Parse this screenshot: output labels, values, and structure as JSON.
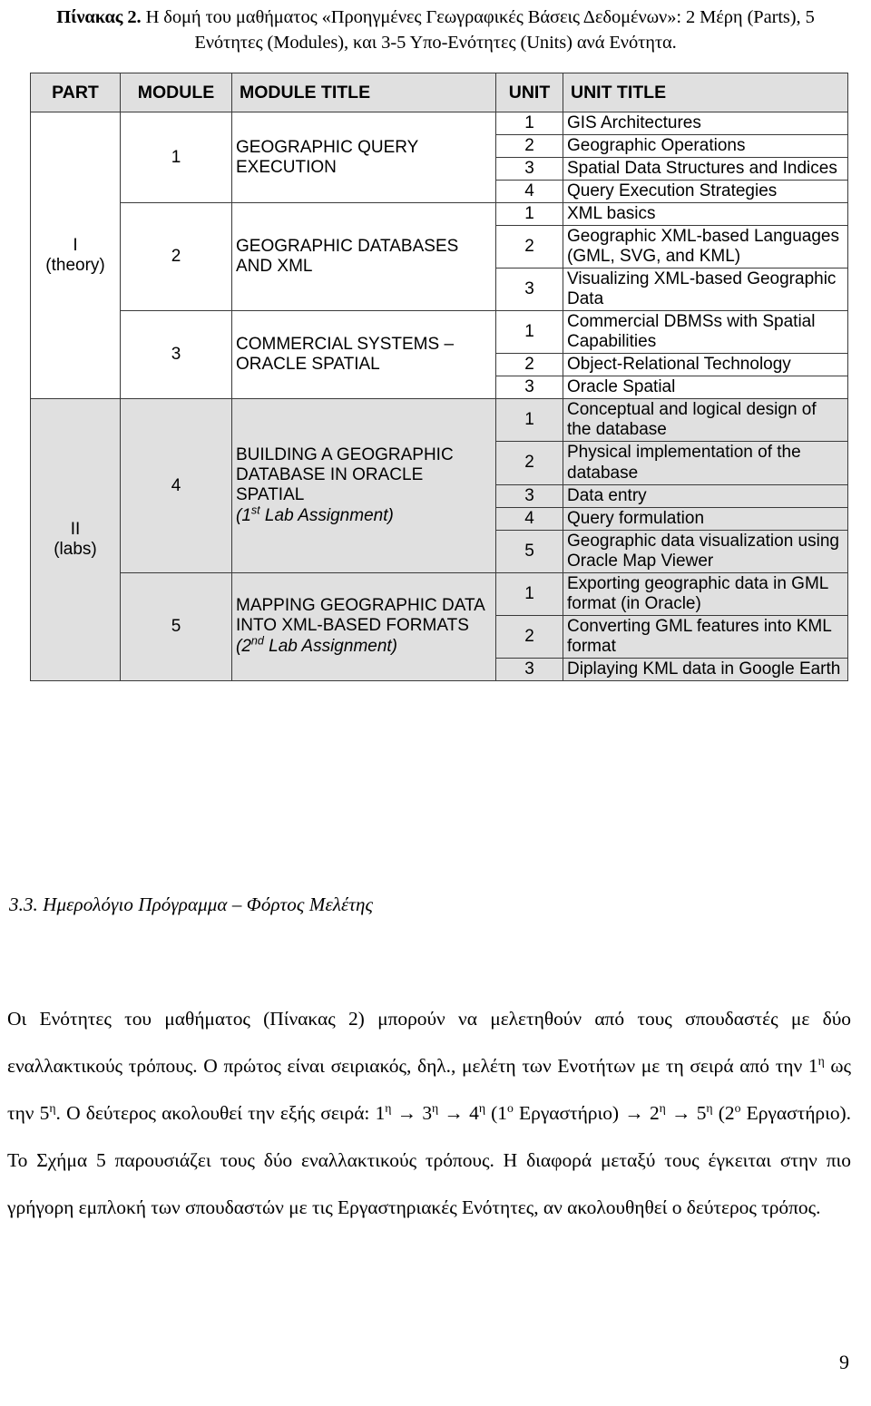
{
  "caption": {
    "lead": "Πίνακας 2.",
    "rest": " Η δομή του μαθήματος «Προηγμένες Γεωγραφικές Βάσεις Δεδομένων»: 2 Μέρη (Parts), 5 Ενότητες (Modules), και 3-5 Υπο-Ενότητες (Units) ανά Ενότητα."
  },
  "table": {
    "headers": {
      "part": "PART",
      "module": "MODULE",
      "module_title": "MODULE TITLE",
      "unit": "UNIT",
      "unit_title": "UNIT TITLE"
    },
    "parts": [
      {
        "label": "I",
        "sublabel": "(theory)",
        "shaded": false,
        "modules": [
          {
            "number": "1",
            "title": "GEOGRAPHIC QUERY EXECUTION",
            "subtitle": null,
            "units": [
              {
                "n": "1",
                "title": "GIS Architectures"
              },
              {
                "n": "2",
                "title": "Geographic Operations"
              },
              {
                "n": "3",
                "title": "Spatial Data Structures and Indices"
              },
              {
                "n": "4",
                "title": "Query Execution Strategies"
              }
            ]
          },
          {
            "number": "2",
            "title": "GEOGRAPHIC DATABASES AND XML",
            "subtitle": null,
            "units": [
              {
                "n": "1",
                "title": "XML basics"
              },
              {
                "n": "2",
                "title": "Geographic XML-based Languages (GML, SVG, and KML)"
              },
              {
                "n": "3",
                "title": "Visualizing XML-based Geographic Data"
              }
            ]
          },
          {
            "number": "3",
            "title": "COMMERCIAL SYSTEMS – ORACLE SPATIAL",
            "subtitle": null,
            "units": [
              {
                "n": "1",
                "title": "Commercial DBMSs with Spatial Capabilities"
              },
              {
                "n": "2",
                "title": "Object-Relational Technology"
              },
              {
                "n": "3",
                "title": "Oracle Spatial"
              }
            ]
          }
        ]
      },
      {
        "label": "II",
        "sublabel": "(labs)",
        "shaded": true,
        "modules": [
          {
            "number": "4",
            "title": "BUILDING A GEOGRAPHIC DATABASE IN ORACLE SPATIAL",
            "subtitle": {
              "pre": "(1",
              "sup": "st",
              "post": " Lab Assignment)"
            },
            "units": [
              {
                "n": "1",
                "title": "Conceptual and logical design of the database"
              },
              {
                "n": "2",
                "title": "Physical implementation of the database"
              },
              {
                "n": "3",
                "title": "Data entry"
              },
              {
                "n": "4",
                "title": "Query formulation"
              },
              {
                "n": "5",
                "title": "Geographic data visualization using Oracle Map Viewer"
              }
            ]
          },
          {
            "number": "5",
            "title": "MAPPING GEOGRAPHIC DATA INTO XML-BASED FORMATS",
            "subtitle": {
              "pre": "(2",
              "sup": "nd",
              "post": " Lab Assignment)"
            },
            "units": [
              {
                "n": "1",
                "title": "Exporting geographic data in GML format (in Oracle)"
              },
              {
                "n": "2",
                "title": "Converting GML features into KML format"
              },
              {
                "n": "3",
                "title": "Diplaying KML data in Google Earth"
              }
            ]
          }
        ]
      }
    ]
  },
  "section": {
    "heading": "3.3. Ημερολόγιο Πρόγραμμα – Φόρτος Μελέτης"
  },
  "paragraph": {
    "s1": "Οι Ενότητες του μαθήματος (Πίνακας 2) μπορούν να μελετηθούν από τους σπουδαστές με δύο εναλλακτικούς τρόπους. Ο πρώτος είναι σειριακός, δηλ., μελέτη των Ενοτήτων με τη σειρά από την 1",
    "sup1": "η",
    "s2": " ως την 5",
    "sup2": "η",
    "s3": ". Ο δεύτερος ακολουθεί την εξής σειρά: 1",
    "sup3": "η",
    "s4": " → 3",
    "sup4": "η",
    "s5": " → 4",
    "sup5": "η",
    "s6": " (1",
    "sup6": "ο",
    "s7": " Εργαστήριο) → 2",
    "sup7": "η",
    "s8": " → 5",
    "sup8": "η",
    "s9": " (2",
    "sup9": "ο",
    "s10": " Εργαστήριο). Το Σχήμα 5 παρουσιάζει τους δύο εναλλακτικούς τρόπους. Η διαφορά μεταξύ τους έγκειται στην πιο γρήγορη εμπλοκή των σπουδαστών με τις Εργαστηριακές Ενότητες, αν ακολουθηθεί ο δεύτερος τρόπος."
  },
  "footer": {
    "page_number": "9"
  },
  "colors": {
    "shading": "#e0e0e0",
    "border": "#3a3a3a",
    "text": "#000000"
  }
}
